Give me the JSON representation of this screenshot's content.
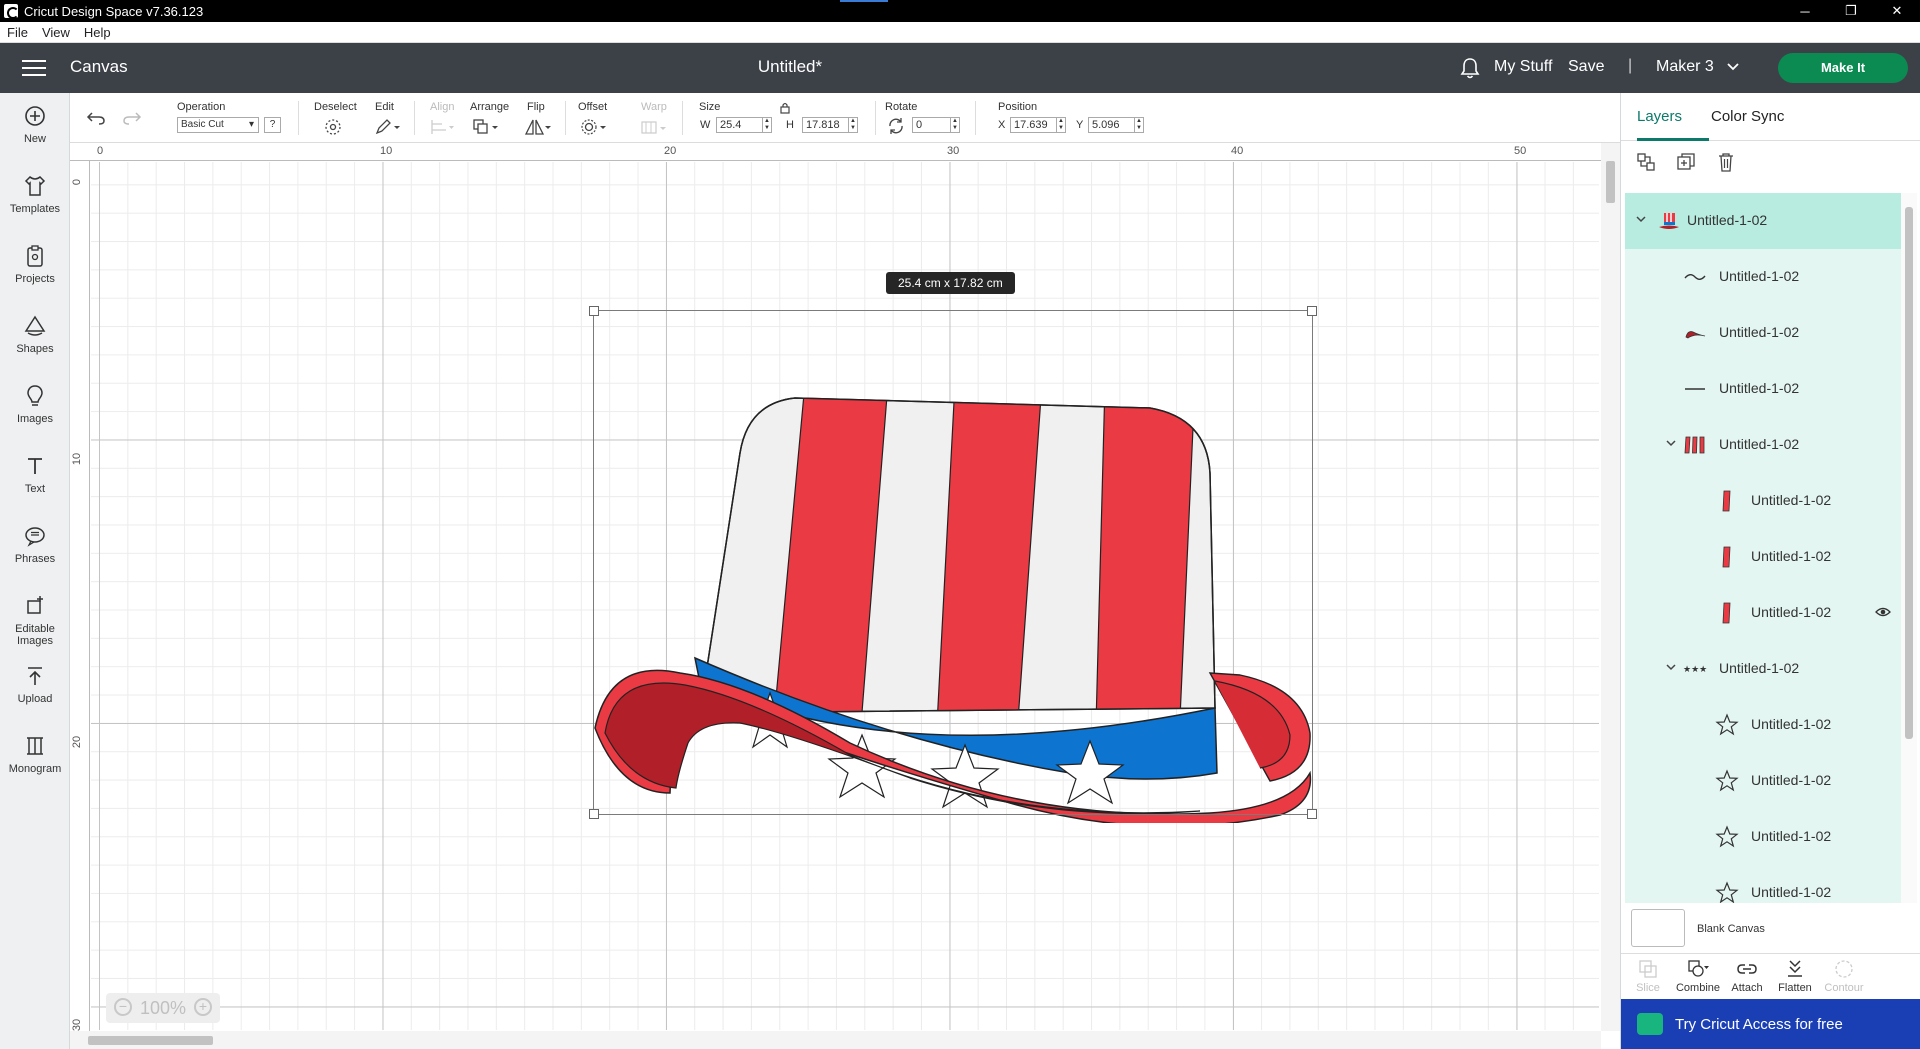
{
  "window": {
    "title": "Cricut Design Space  v7.36.123",
    "controls": [
      "─",
      "❐",
      "✕"
    ]
  },
  "menu": [
    "File",
    "View",
    "Help"
  ],
  "header": {
    "section": "Canvas",
    "doc_title": "Untitled*",
    "my_stuff": "My Stuff",
    "save": "Save",
    "separator": "|",
    "machine": "Maker 3",
    "make_it": "Make It"
  },
  "sidebar": [
    {
      "label": "New",
      "icon": "plus-circle-icon"
    },
    {
      "label": "Templates",
      "icon": "shirt-icon"
    },
    {
      "label": "Projects",
      "icon": "clipboard-icon"
    },
    {
      "label": "Shapes",
      "icon": "shapes-icon"
    },
    {
      "label": "Images",
      "icon": "lightbulb-icon"
    },
    {
      "label": "Text",
      "icon": "text-icon"
    },
    {
      "label": "Phrases",
      "icon": "speech-bubble-icon"
    },
    {
      "label": "Editable Images",
      "icon": "editable-image-icon"
    },
    {
      "label": "Upload",
      "icon": "upload-icon"
    },
    {
      "label": "Monogram",
      "icon": "monogram-icon"
    }
  ],
  "toolbar": {
    "operation_label": "Operation",
    "operation_value": "Basic Cut",
    "help": "?",
    "deselect_label": "Deselect",
    "edit_label": "Edit",
    "align_label": "Align",
    "arrange_label": "Arrange",
    "flip_label": "Flip",
    "offset_label": "Offset",
    "warp_label": "Warp",
    "size_label": "Size",
    "w_label": "W",
    "w_value": "25.4",
    "h_label": "H",
    "h_value": "17.818",
    "rotate_label": "Rotate",
    "rotate_value": "0",
    "position_label": "Position",
    "x_label": "X",
    "x_value": "17.639",
    "y_label": "Y",
    "y_value": "5.096"
  },
  "canvas": {
    "ruler_top": [
      "0",
      "10",
      "20",
      "30",
      "40",
      "50"
    ],
    "ruler_left": [
      "0",
      "10",
      "20",
      "30"
    ],
    "dimension_tooltip": "25.4  cm x 17.82  cm",
    "zoom": "100%",
    "colors": {
      "hat_red": "#ea3b45",
      "hat_white": "#f0f0f0",
      "band_blue": "#0d74cf",
      "brim_dark": "#b11f28"
    }
  },
  "panel": {
    "tabs": [
      "Layers",
      "Color Sync"
    ],
    "layers": [
      {
        "name": "Untitled-1-02",
        "indent": 0,
        "expand": true,
        "thumb": "hat",
        "selected": true
      },
      {
        "name": "Untitled-1-02",
        "indent": 1,
        "thumb": "curve"
      },
      {
        "name": "Untitled-1-02",
        "indent": 1,
        "thumb": "red-curve"
      },
      {
        "name": "Untitled-1-02",
        "indent": 1,
        "thumb": "line"
      },
      {
        "name": "Untitled-1-02",
        "indent": 1,
        "expand": true,
        "thumb": "stripes"
      },
      {
        "name": "Untitled-1-02",
        "indent": 2,
        "thumb": "stripe"
      },
      {
        "name": "Untitled-1-02",
        "indent": 2,
        "thumb": "stripe"
      },
      {
        "name": "Untitled-1-02",
        "indent": 2,
        "thumb": "stripe",
        "eye": true
      },
      {
        "name": "Untitled-1-02",
        "indent": 1,
        "expand": true,
        "thumb": "stars"
      },
      {
        "name": "Untitled-1-02",
        "indent": 2,
        "thumb": "star"
      },
      {
        "name": "Untitled-1-02",
        "indent": 2,
        "thumb": "star"
      },
      {
        "name": "Untitled-1-02",
        "indent": 2,
        "thumb": "star"
      },
      {
        "name": "Untitled-1-02",
        "indent": 2,
        "thumb": "star"
      }
    ],
    "blank_canvas": "Blank Canvas",
    "bottom_tools": [
      {
        "label": "Slice",
        "enabled": false
      },
      {
        "label": "Combine",
        "enabled": true
      },
      {
        "label": "Attach",
        "enabled": true
      },
      {
        "label": "Flatten",
        "enabled": true
      },
      {
        "label": "Contour",
        "enabled": false
      }
    ],
    "try_access": "Try Cricut Access for free"
  }
}
